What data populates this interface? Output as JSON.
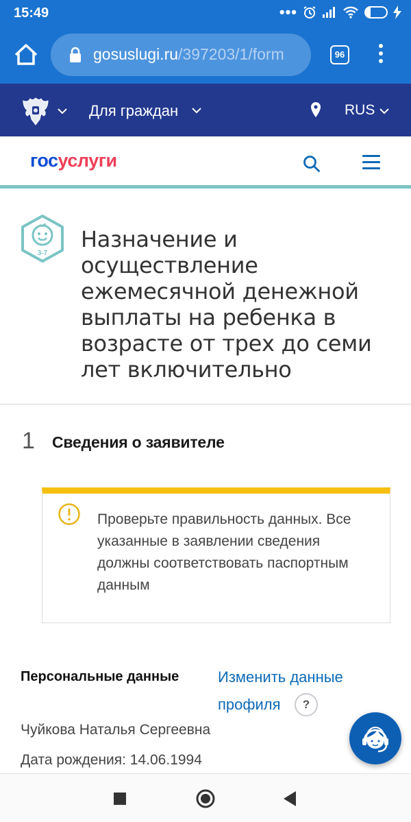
{
  "status_bar": {
    "time": "15:49",
    "battery": "22",
    "battery_level": 0.22,
    "icons": [
      "more-dots-icon",
      "alarm-icon",
      "signal-icon",
      "wifi-icon",
      "battery-icon",
      "charging-icon"
    ]
  },
  "browser": {
    "url_host": "gosuslugi.ru",
    "url_path": "/397203/1/form",
    "tab_count": "96"
  },
  "site_header": {
    "nav_label": "Для граждан",
    "language": "RUS"
  },
  "logo": {
    "part1": "гос",
    "part2": "услуги",
    "color1": "#0d4cd3",
    "color2": "#ee3f58"
  },
  "service": {
    "icon_badge": "3-7",
    "title": "Назначение и осуществление ежемесячной денежной выплаты на ребенка в возрасте от трех до семи лет включительно"
  },
  "step": {
    "number": "1",
    "title": "Сведения о заявителе"
  },
  "warning": {
    "text": "Проверьте правильность данных. Все указанные в заявлении сведения должны соответствовать паспортным данным",
    "accent": "#f5bf0f"
  },
  "personal_data": {
    "label": "Персональные данные",
    "edit_link": "Изменить данные профиля",
    "help": "?",
    "full_name": "Чуйкова Наталья Сергеевна",
    "birth_date": "Дата рождения: 14.06.1994"
  },
  "colors": {
    "browser_bar": "#1a73d0",
    "site_header": "#22398e",
    "link": "#0d6ab7"
  }
}
